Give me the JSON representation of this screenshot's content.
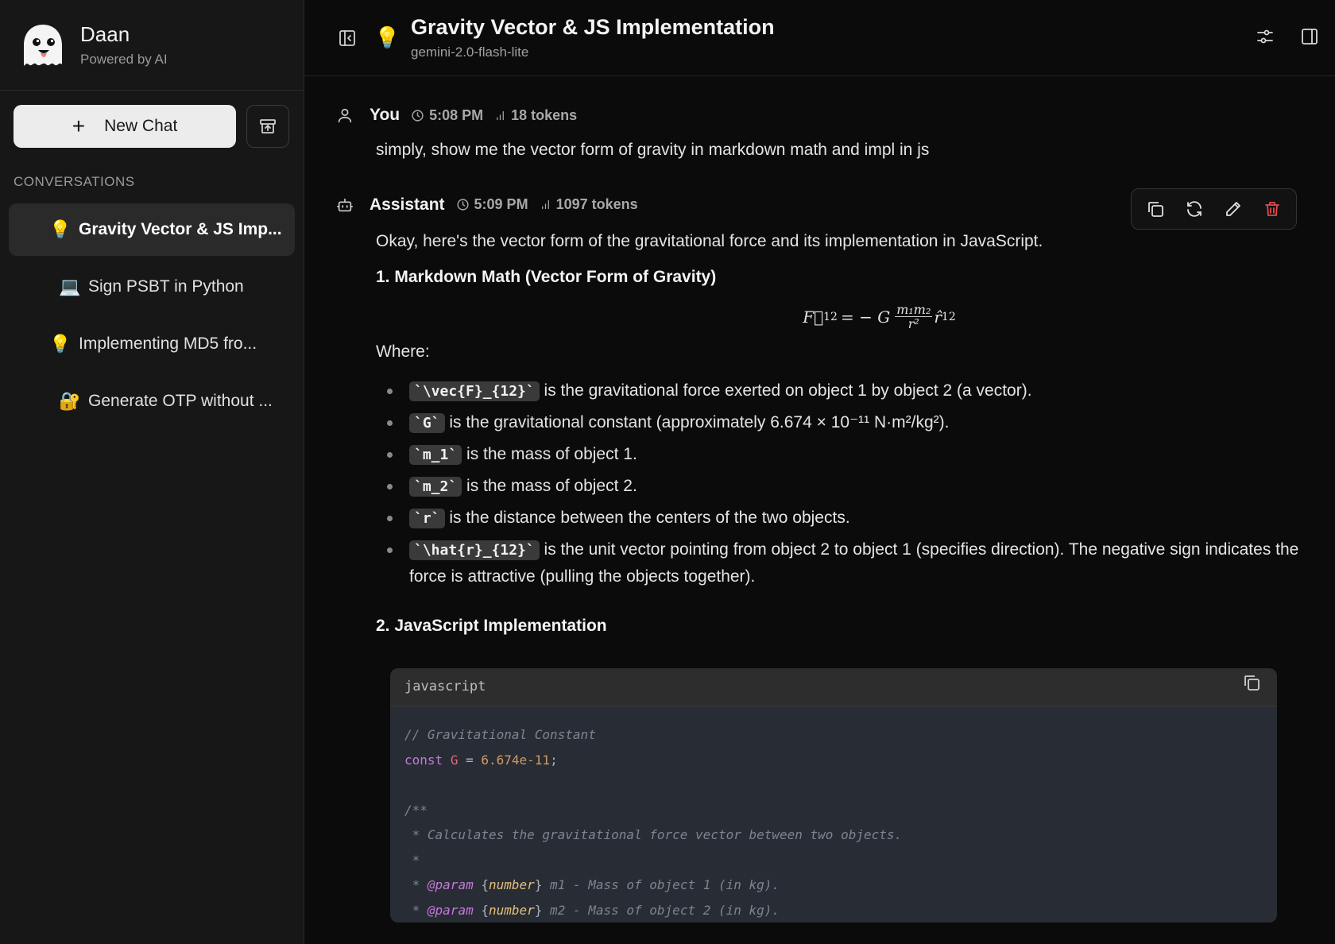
{
  "app": {
    "name": "Daan",
    "subtitle": "Powered by AI"
  },
  "sidebar": {
    "new_chat_label": "New Chat",
    "section_label": "CONVERSATIONS",
    "conversations": [
      {
        "emoji": "💡",
        "title": "Gravity Vector & JS Imp...",
        "active": true
      },
      {
        "emoji": "💻",
        "title": "Sign PSBT in Python",
        "active": false
      },
      {
        "emoji": "💡",
        "title": "Implementing MD5 fro...",
        "active": false
      },
      {
        "emoji": "🔐",
        "title": "Generate OTP without ...",
        "active": false
      }
    ]
  },
  "header": {
    "emoji": "💡",
    "title": "Gravity Vector & JS Implementation",
    "model": "gemini-2.0-flash-lite"
  },
  "messages": {
    "user": {
      "author": "You",
      "time": "5:08 PM",
      "tokens": "18 tokens",
      "text": "simply, show me the vector form of gravity in markdown math and impl in js"
    },
    "assistant": {
      "author": "Assistant",
      "time": "5:09 PM",
      "tokens": "1097 tokens",
      "intro": "Okay, here's the vector form of the gravitational force and its implementation in JavaScript.",
      "heading_math": "1. Markdown Math (Vector Form of Gravity)",
      "formula": {
        "lhs": "F⃗",
        "lhs_sub": "12",
        "eq": "= − G",
        "numerator": "m₁m₂",
        "denominator": "r²",
        "rhs": "r̂",
        "rhs_sub": "12"
      },
      "where": "Where:",
      "bullets": [
        {
          "code": "`\\vec{F}_{12}`",
          "text": " is the gravitational force exerted on object 1 by object 2 (a vector)."
        },
        {
          "code": "`G`",
          "text": " is the gravitational constant (approximately 6.674 × 10⁻¹¹ N·m²/kg²)."
        },
        {
          "code": "`m_1`",
          "text": " is the mass of object 1."
        },
        {
          "code": "`m_2`",
          "text": " is the mass of object 2."
        },
        {
          "code": "`r`",
          "text": " is the distance between the centers of the two objects."
        },
        {
          "code": "`\\hat{r}_{12}`",
          "text": " is the unit vector pointing from object 2 to object 1 (specifies direction). The negative sign indicates the force is attractive (pulling the objects together)."
        }
      ],
      "heading_js": "2. JavaScript Implementation",
      "code": {
        "language": "javascript",
        "line1": "// Gravitational Constant",
        "line2_kw": "const",
        "line2_var": "G",
        "line2_op": " = ",
        "line2_num": "6.674e-11",
        "line2_end": ";",
        "line4": "/**",
        "line5": " * Calculates the gravitational force vector between two objects.",
        "line6": " *",
        "line7_pre": " * ",
        "line7_tag": "@param",
        "line7_type": "number",
        "line7_rest": " m1 - Mass of object 1 (in kg).",
        "line8_pre": " * ",
        "line8_tag": "@param",
        "line8_type": "number",
        "line8_rest": " m2 - Mass of object 2 (in kg)."
      }
    }
  },
  "colors": {
    "delete": "#e5484d",
    "sidebar_bg": "#171717",
    "code_bg": "#282c34"
  }
}
